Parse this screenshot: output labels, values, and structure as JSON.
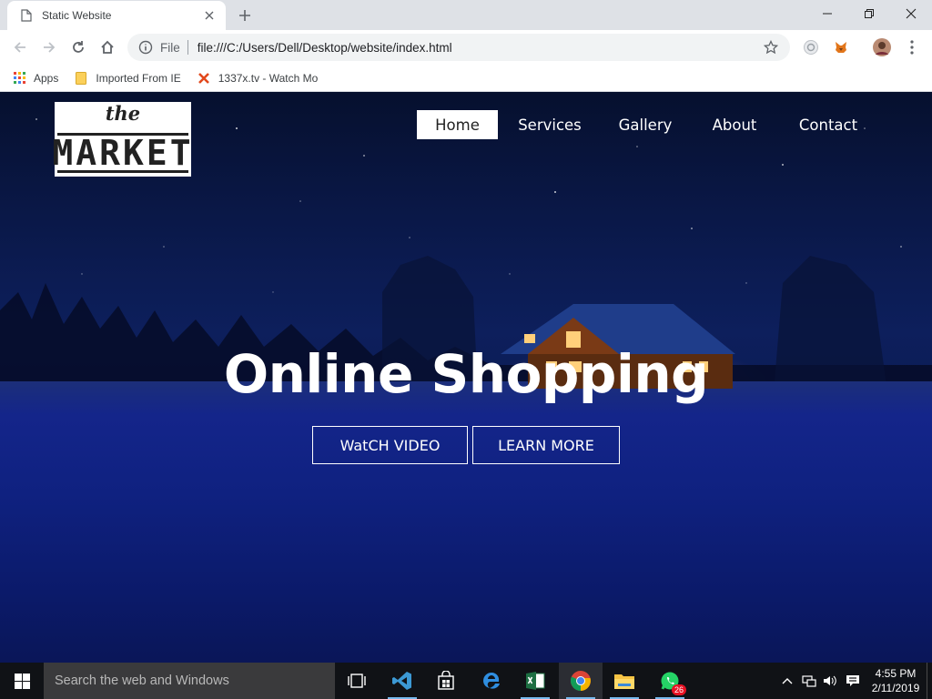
{
  "browser": {
    "tab_title": "Static Website",
    "url_scheme": "File",
    "url": "file:///C:/Users/Dell/Desktop/website/index.html",
    "bookmarks": [
      {
        "label": "Apps",
        "icon": "apps-grid-icon"
      },
      {
        "label": "Imported From IE",
        "icon": "folder-icon"
      },
      {
        "label": "1337x.tv - Watch Mo",
        "icon": "1337x-favicon-icon"
      }
    ]
  },
  "site": {
    "logo": {
      "top": "the",
      "bottom": "MARKET"
    },
    "nav": [
      {
        "label": "Home",
        "active": true
      },
      {
        "label": "Services",
        "active": false
      },
      {
        "label": "Gallery",
        "active": false
      },
      {
        "label": "About",
        "active": false
      },
      {
        "label": "Contact",
        "active": false
      }
    ],
    "hero_title": "Online Shopping",
    "hero_buttons": [
      "WatCH VIDEO",
      "LEARN MORE"
    ]
  },
  "taskbar": {
    "search_placeholder": "Search the web and Windows",
    "whatsapp_badge": "26",
    "time": "4:55 PM",
    "date": "2/11/2019"
  },
  "colors": {
    "accent_blue": "#0d1f5c",
    "taskbar": "#101216",
    "nav_active_bg": "#ffffff"
  }
}
